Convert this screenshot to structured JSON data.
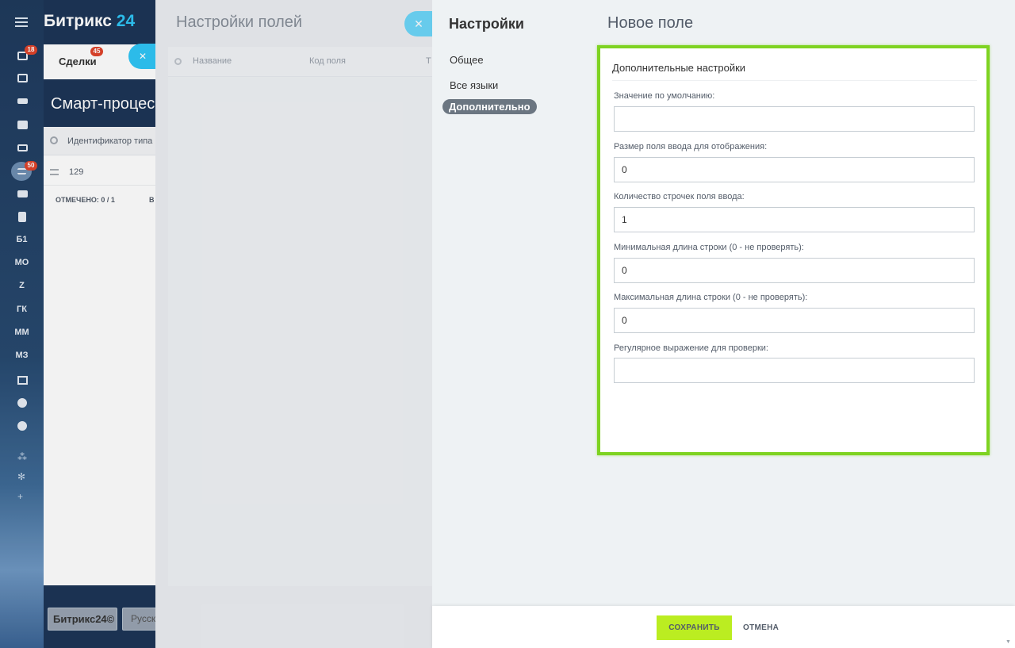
{
  "app": {
    "logo_main": "Битрикс",
    "logo_num": "24"
  },
  "rail": {
    "tasks_badge": "18",
    "crm_badge": "50",
    "text_items": [
      "Б1",
      "МО",
      "Z",
      "ГК",
      "ММ",
      "МЗ"
    ]
  },
  "base": {
    "deals_label": "Сделки",
    "deals_badge": "45",
    "page_title": "Смарт-процесс",
    "grid_column": "Идентификатор типа",
    "grid_row_value": "129",
    "marked_label": "ОТМЕЧЕНО: 0 / 1",
    "marked_extra": "В",
    "footer_logo": "Битрикс24",
    "footer_lang": "Русский"
  },
  "slider1": {
    "title": "Настройки полей",
    "columns": [
      "Название",
      "Код поля",
      "Т"
    ]
  },
  "slider2": {
    "nav_title": "Настройки",
    "nav": [
      {
        "label": "Общее",
        "active": false
      },
      {
        "label": "Все языки",
        "active": false
      },
      {
        "label": "Дополнительно",
        "active": true
      }
    ],
    "title": "Новое поле",
    "section_title": "Дополнительные настройки",
    "fields": [
      {
        "label": "Значение по умолчанию:",
        "value": ""
      },
      {
        "label": "Размер поля ввода для отображения:",
        "value": "0"
      },
      {
        "label": "Количество строчек поля ввода:",
        "value": "1"
      },
      {
        "label": "Минимальная длина строки (0 - не проверять):",
        "value": "0"
      },
      {
        "label": "Максимальная длина строки (0 - не проверять):",
        "value": "0"
      },
      {
        "label": "Регулярное выражение для проверки:",
        "value": ""
      }
    ],
    "save_label": "СОХРАНИТЬ",
    "cancel_label": "ОТМЕНА"
  },
  "colors": {
    "accent_blue": "#2fc6f6",
    "highlight_green": "#7ed321",
    "save_button": "#bbed21",
    "badge_red": "#e0442b"
  }
}
